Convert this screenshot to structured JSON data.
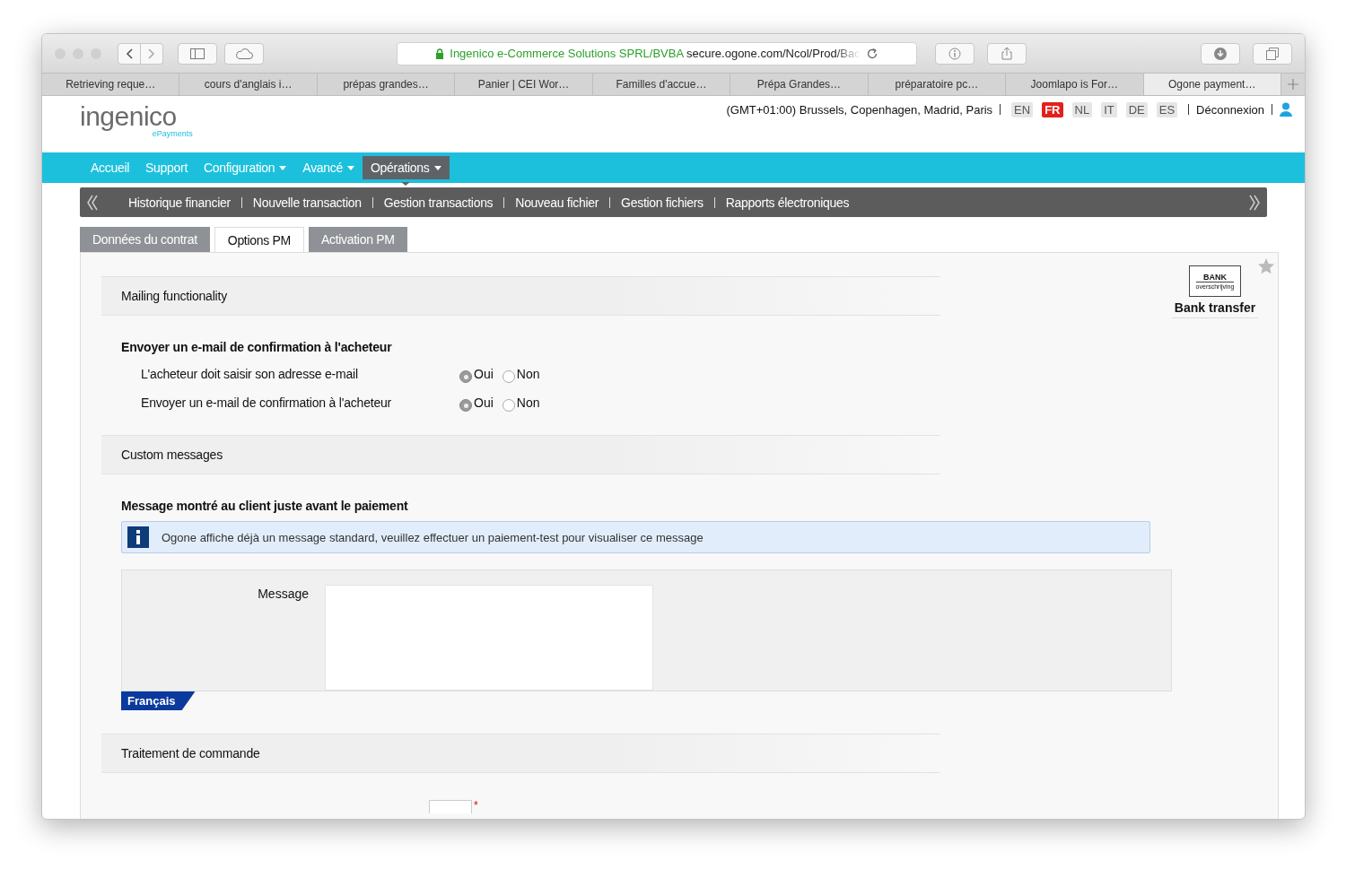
{
  "browser": {
    "secure_name": "Ingenico e-Commerce Solutions SPRL/BVBA",
    "url": "secure.ogone.com/Ncol/Prod/Bac",
    "tabs": [
      {
        "label": "Retrieving reque…",
        "selected": false
      },
      {
        "label": "cours d'anglais i…",
        "selected": false
      },
      {
        "label": "prépas grandes…",
        "selected": false
      },
      {
        "label": "Panier | CEI Wor…",
        "selected": false
      },
      {
        "label": "Familles d'accue…",
        "selected": false
      },
      {
        "label": "Prépa Grandes…",
        "selected": false
      },
      {
        "label": "préparatoire pc…",
        "selected": false
      },
      {
        "label": "Joomlapo is For…",
        "selected": false
      },
      {
        "label": "Ogone payment…",
        "selected": true
      }
    ]
  },
  "header": {
    "logo": "ingenico",
    "logo_tagline": "ePayments",
    "timezone": "(GMT+01:00) Brussels, Copenhagen, Madrid, Paris",
    "languages": [
      {
        "code": "EN",
        "selected": false
      },
      {
        "code": "FR",
        "selected": true
      },
      {
        "code": "NL",
        "selected": false
      },
      {
        "code": "IT",
        "selected": false
      },
      {
        "code": "DE",
        "selected": false
      },
      {
        "code": "ES",
        "selected": false
      }
    ],
    "logout": "Déconnexion"
  },
  "main_nav": [
    {
      "label": "Accueil",
      "dropdown": false,
      "selected": false
    },
    {
      "label": "Support",
      "dropdown": false,
      "selected": false
    },
    {
      "label": "Configuration",
      "dropdown": true,
      "selected": false
    },
    {
      "label": "Avancé",
      "dropdown": true,
      "selected": false
    },
    {
      "label": "Opérations",
      "dropdown": true,
      "selected": true
    }
  ],
  "sub_nav": [
    "Historique financier",
    "Nouvelle transaction",
    "Gestion transactions",
    "Nouveau fichier",
    "Gestion fichiers",
    "Rapports électroniques"
  ],
  "content_tabs": [
    {
      "label": "Données du contrat",
      "selected": false
    },
    {
      "label": "Options PM",
      "selected": true
    },
    {
      "label": "Activation PM",
      "selected": false
    }
  ],
  "payment_method": {
    "logo_top": "BANK",
    "logo_bottom": "overschrijving",
    "name": "Bank transfer"
  },
  "sections": [
    {
      "title": "Mailing functionality",
      "groups": [
        {
          "kind": "radios",
          "heading": "Envoyer un e-mail de confirmation à l'acheteur",
          "rows": [
            {
              "label": "L'acheteur doit saisir son adresse e-mail",
              "options": [
                {
                  "label": "Oui",
                  "selected": true
                },
                {
                  "label": "Non",
                  "selected": false
                }
              ]
            },
            {
              "label": "Envoyer un e-mail de confirmation à l'acheteur",
              "options": [
                {
                  "label": "Oui",
                  "selected": true
                },
                {
                  "label": "Non",
                  "selected": false
                }
              ]
            }
          ]
        }
      ]
    },
    {
      "title": "Custom messages",
      "groups": [
        {
          "kind": "message",
          "heading": "Message montré au client juste avant le paiement",
          "info": "Ogone affiche déjà un message standard, veuillez effectuer un paiement-test pour visualiser ce message",
          "field_label": "Message",
          "language": "Français"
        }
      ]
    },
    {
      "title": "Traitement de commande",
      "groups": [
        {
          "kind": "partial_field",
          "mark": "*"
        }
      ]
    }
  ]
}
